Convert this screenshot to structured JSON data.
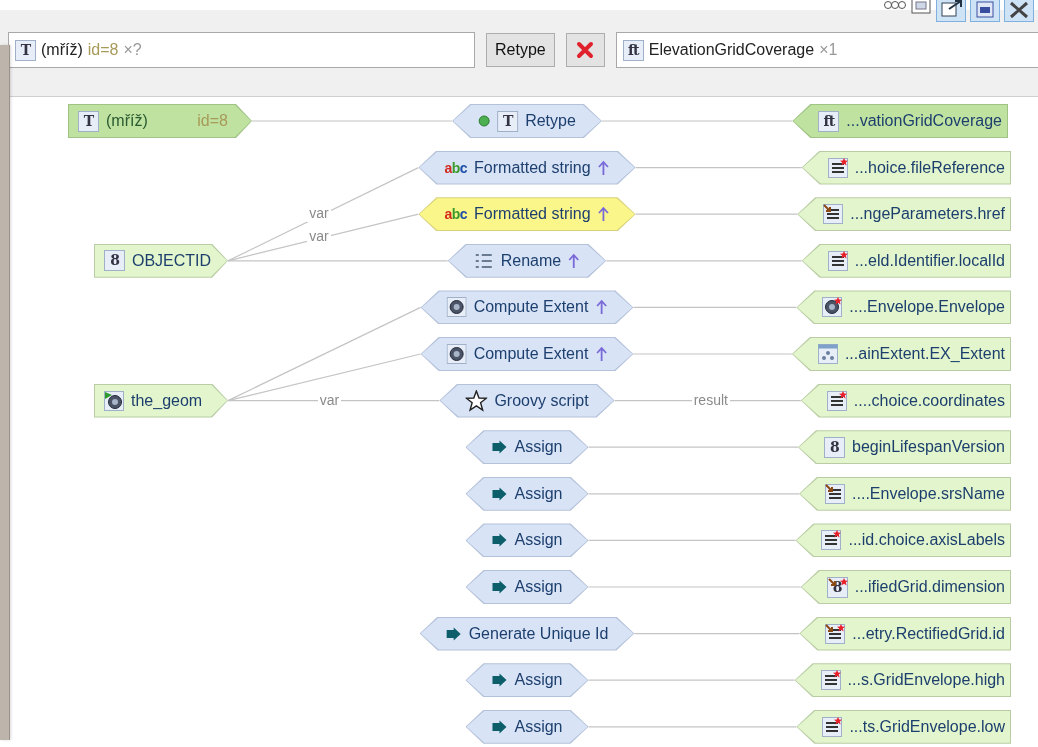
{
  "source_type": {
    "icon": {
      "kind": "letter",
      "text": "T"
    },
    "name": "(mříž)",
    "id": "id=8",
    "count": "×?"
  },
  "retype_button": "Retype",
  "target_type": {
    "icon": {
      "kind": "letter",
      "text": "ft"
    },
    "name": "ElevationGridCoverage",
    "count": "×1"
  },
  "diagram": {
    "type_mapping": {
      "source": {
        "icon": {
          "kind": "letter",
          "text": "T"
        },
        "name": "(mříž)",
        "id": "id=8"
      },
      "function": {
        "label": "Retype",
        "dot": true,
        "icon": {
          "kind": "letter",
          "text": "T"
        },
        "up_arrow": false,
        "highlighted": false
      },
      "target": {
        "icon": {
          "kind": "letter",
          "text": "ft"
        },
        "label": "...vationGridCoverage"
      }
    },
    "sources": [
      {
        "name": "OBJECTID",
        "icon": {
          "kind": "letter",
          "text": "8"
        },
        "functions": [
          {
            "label": "Formatted string",
            "icon": {
              "kind": "abc",
              "text": "abc"
            },
            "up_arrow": true,
            "highlighted": false,
            "in_label": "var",
            "target": {
              "label": "...hoice.fileReference",
              "icon": {
                "kind": "lines",
                "required": true,
                "reference": false
              }
            }
          },
          {
            "label": "Formatted string",
            "icon": {
              "kind": "abc",
              "text": "abc"
            },
            "up_arrow": true,
            "highlighted": true,
            "in_label": "var",
            "target": {
              "label": "...ngeParameters.href",
              "icon": {
                "kind": "lines",
                "required": false,
                "reference": true
              }
            }
          },
          {
            "label": "Rename",
            "icon": {
              "kind": "list"
            },
            "up_arrow": true,
            "highlighted": false,
            "target": {
              "label": "...eld.Identifier.localId",
              "icon": {
                "kind": "lines",
                "required": true,
                "reference": false
              }
            }
          }
        ]
      },
      {
        "name": "the_geom",
        "icon": {
          "kind": "geometry"
        },
        "functions": [
          {
            "label": "Compute Extent",
            "icon": {
              "kind": "sphere"
            },
            "up_arrow": true,
            "highlighted": false,
            "target": {
              "label": "....Envelope.Envelope",
              "icon": {
                "kind": "sphere",
                "required": true,
                "reference": false
              }
            }
          },
          {
            "label": "Compute Extent",
            "icon": {
              "kind": "sphere"
            },
            "up_arrow": true,
            "highlighted": false,
            "target": {
              "label": "...ainExtent.EX_Extent",
              "icon": {
                "kind": "extent",
                "required": false,
                "reference": false
              }
            }
          },
          {
            "label": "Groovy script",
            "icon": {
              "kind": "star"
            },
            "up_arrow": false,
            "highlighted": false,
            "in_label": "var",
            "out_label": "result",
            "target": {
              "label": "....choice.coordinates",
              "icon": {
                "kind": "lines",
                "required": true,
                "reference": false
              }
            }
          }
        ]
      }
    ],
    "unlinked": [
      {
        "label": "Assign",
        "icon": {
          "kind": "arrow"
        },
        "up_arrow": false,
        "highlighted": false,
        "target": {
          "label": "beginLifespanVersion",
          "icon": {
            "kind": "letter",
            "text": "8",
            "required": false,
            "reference": false
          }
        }
      },
      {
        "label": "Assign",
        "icon": {
          "kind": "arrow"
        },
        "up_arrow": false,
        "highlighted": false,
        "target": {
          "label": "....Envelope.srsName",
          "icon": {
            "kind": "lines",
            "required": false,
            "reference": true
          }
        }
      },
      {
        "label": "Assign",
        "icon": {
          "kind": "arrow"
        },
        "up_arrow": false,
        "highlighted": false,
        "target": {
          "label": "...id.choice.axisLabels",
          "icon": {
            "kind": "lines",
            "required": true,
            "reference": false
          }
        }
      },
      {
        "label": "Assign",
        "icon": {
          "kind": "arrow"
        },
        "up_arrow": false,
        "highlighted": false,
        "target": {
          "label": "...ifiedGrid.dimension",
          "icon": {
            "kind": "letter",
            "text": "8",
            "required": true,
            "reference": true
          }
        }
      },
      {
        "label": "Generate Unique Id",
        "icon": {
          "kind": "arrow"
        },
        "up_arrow": false,
        "highlighted": false,
        "target": {
          "label": "...etry.RectifiedGrid.id",
          "icon": {
            "kind": "lines",
            "required": true,
            "reference": true
          }
        }
      },
      {
        "label": "Assign",
        "icon": {
          "kind": "arrow"
        },
        "up_arrow": false,
        "highlighted": false,
        "target": {
          "label": "...s.GridEnvelope.high",
          "icon": {
            "kind": "lines",
            "required": true,
            "reference": false
          }
        }
      },
      {
        "label": "Assign",
        "icon": {
          "kind": "arrow"
        },
        "up_arrow": false,
        "highlighted": false,
        "target": {
          "label": "...ts.GridEnvelope.low",
          "icon": {
            "kind": "lines",
            "required": true,
            "reference": false
          }
        }
      }
    ]
  }
}
